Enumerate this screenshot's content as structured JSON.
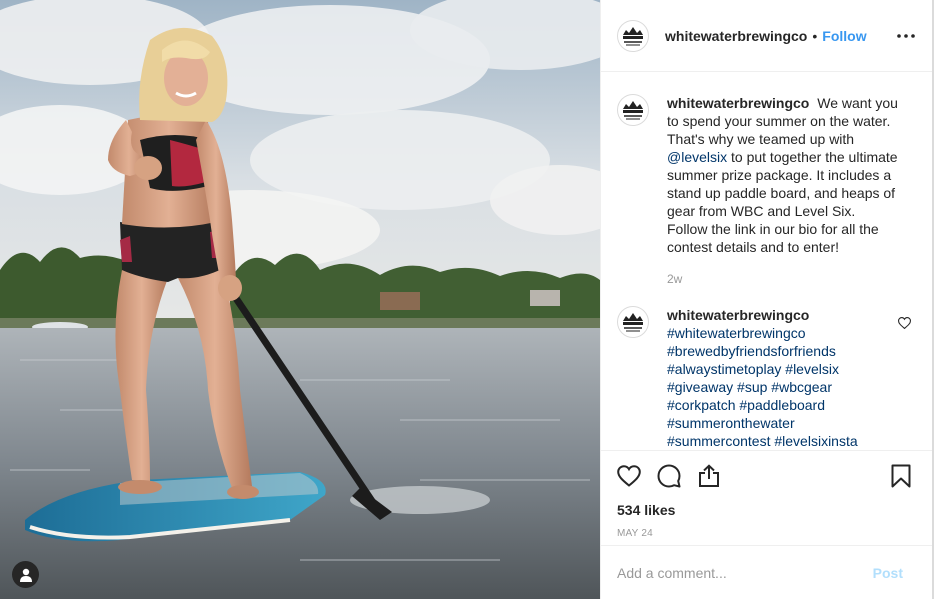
{
  "post": {
    "account": "whitewaterbrewingco",
    "follow_label": "Follow",
    "separator": "•",
    "avatar_text": "WHITEWATER"
  },
  "caption": {
    "username": "whitewaterbrewingco",
    "text_before_mention": "We want you to spend your summer on the water. That's why we teamed up with",
    "mention": "@levelsix",
    "text_after_mention": "to put together the ultimate summer prize package. It includes a stand up paddle board, and heaps of gear from WBC and Level Six. Follow the link in our bio for all the contest details and to enter!",
    "time": "2w"
  },
  "comment": {
    "username": "whitewaterbrewingco",
    "hashtags": [
      "#whitewaterbrewingco",
      "#brewedbyfriendsforfriends",
      "#alwaystimetoplay",
      "#levelsix",
      "#giveaway",
      "#sup",
      "#wbcgear",
      "#corkpatch",
      "#paddleboard",
      "#summeronthewater",
      "#summercontest",
      "#levelsixinsta"
    ]
  },
  "actions": {
    "likes": "534 likes",
    "date": "MAY 24",
    "icons": [
      "heart-icon",
      "comment-icon",
      "share-icon",
      "bookmark-icon"
    ]
  },
  "add_comment": {
    "placeholder": "Add a comment...",
    "post_label": "Post"
  },
  "colors": {
    "link": "#3897f0",
    "hashtag": "#003569",
    "post_disabled": "#b2dffc",
    "muted": "#999999"
  }
}
